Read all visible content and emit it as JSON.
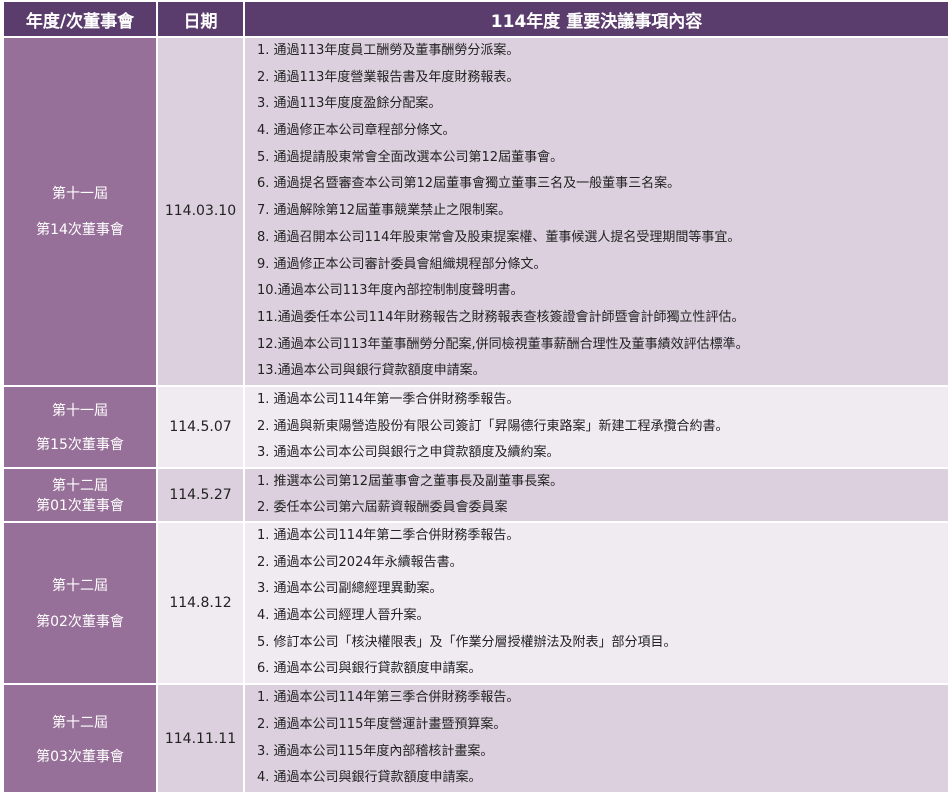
{
  "header": {
    "col1": "年度/次董事會",
    "col2": "日期",
    "col3": "114年度  重要決議事項內容"
  },
  "rows": [
    {
      "term": "第十一屆",
      "meeting": "第14次董事會",
      "date": "114.03.10",
      "items": [
        "1. 通過113年度員工酬勞及董事酬勞分派案。",
        "2. 通過113年度營業報告書及年度財務報表。",
        "3. 通過113年度度盈餘分配案。",
        "4. 通過修正本公司章程部分條文。",
        "5. 通過提請股東常會全面改選本公司第12屆董事會。",
        "6. 通過提名暨審查本公司第12屆董事會獨立董事三名及一般董事三名案。",
        "7. 通過解除第12屆董事競業禁止之限制案。",
        "8. 通過召開本公司114年股東常會及股東提案權、董事候選人提名受理期間等事宜。",
        "9. 通過修正本公司審計委員會組織規程部分條文。",
        "10.通過本公司113年度內部控制制度聲明書。",
        "11.通過委任本公司114年財務報告之財務報表查核簽證會計師暨會計師獨立性評估。",
        "12.通過本公司113年董事酬勞分配案,併同檢視董事薪酬合理性及董事績效評估標準。",
        "13.通過本公司與銀行貸款額度申請案。"
      ]
    },
    {
      "term": "第十一屆",
      "meeting": "第15次董事會",
      "date": "114.5.07",
      "items": [
        "1. 通過本公司114年第一季合併財務季報告。",
        "2. 通過與新東陽營造股份有限公司簽訂「昇陽德行東路案」新建工程承攬合約書。",
        "3. 通過本公司本公司與銀行之申貸款額度及續約案。"
      ]
    },
    {
      "term": "第十二屆",
      "meeting": "第01次董事會",
      "date": "114.5.27",
      "items": [
        "1. 推選本公司第12屆董事會之董事長及副董事長案。",
        "2. 委任本公司第六屆薪資報酬委員會委員案"
      ]
    },
    {
      "term": "第十二屆",
      "meeting": "第02次董事會",
      "date": "114.8.12",
      "items": [
        "1. 通過本公司114年第二季合併財務季報告。",
        "2. 通過本公司2024年永續報告書。",
        "3. 通過本公司副總經理異動案。",
        "4. 通過本公司經理人晉升案。",
        "5. 修訂本公司「核決權限表」及「作業分層授權辦法及附表」部分項目。",
        "6. 通過本公司與銀行貸款額度申請案。"
      ]
    },
    {
      "term": "第十二屆",
      "meeting": "第03次董事會",
      "date": "114.11.11",
      "items": [
        "1. 通過本公司114年第三季合併財務季報告。",
        "2. 通過本公司115年度營運計畫暨預算案。",
        "3. 通過本公司115年度內部稽核計畫案。",
        "4. 通過本公司與銀行貸款額度申請案。"
      ]
    }
  ]
}
